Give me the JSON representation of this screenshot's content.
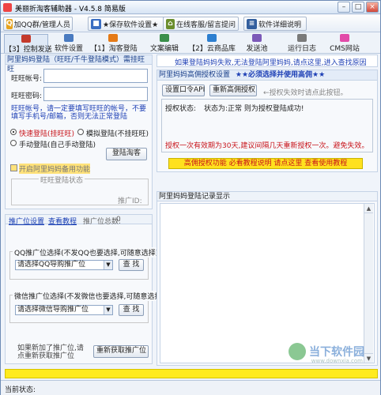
{
  "window": {
    "title": "美丽折淘客辅助器 - V4.5.8 简易版"
  },
  "toolbar": {
    "qq_group": "加QQ群/管理人员",
    "save_settings": "★保存软件设置★",
    "online_support": "在线客服/留言提问",
    "details": "软件详细说明"
  },
  "tabs": [
    {
      "label": "【3】控制发送"
    },
    {
      "label": "软件设置"
    },
    {
      "label": "【1】淘客登陆"
    },
    {
      "label": "文案编辑"
    },
    {
      "label": "【2】云商品库"
    },
    {
      "label": "发送池"
    },
    {
      "label": "运行日志"
    },
    {
      "label": "CMS网站"
    }
  ],
  "login": {
    "header": "阿里妈妈登陆（旺旺/千牛登陆模式）需挂旺旺",
    "account_label": "旺旺帐号:",
    "password_label": "旺旺密码:",
    "account_value": "",
    "password_value": "",
    "note": "旺旺帐号，请一定要填写旺旺的帐号，不要填写手机号/邮箱，否则无法正常登陆",
    "radio_fast": "快速登陆(挂旺旺)",
    "radio_sim": "模拟登陆(不挂旺旺)",
    "radio_manual": "手动登陆(自己手动登陆)",
    "login_button": "登陆淘客",
    "enable_check": "开启阿里妈妈备用功能",
    "status_group": "旺旺登陆状态",
    "promo_id": "推广ID:"
  },
  "promo": {
    "settings_link": "推广位设置",
    "tutorial_link": "查看教程",
    "total_label": "推广位总数:",
    "total_value": "0",
    "qq_group_title": "QQ推广位选择(不发QQ也要选择,可随意选择)",
    "qq_select": "请选择QQ导购推广位",
    "wx_group_title": "微信推广位选择(不发微信也要选择,可随意选择)",
    "wx_select": "请选择微信导购推广位",
    "search_button": "查 找",
    "new_hint": "如果新加了推广位,请点重新获取推广位",
    "refresh_button": "重新获取推广位"
  },
  "auth": {
    "notice": "如果登陆妈妈失败,无法登陆阿里妈妈,请点这里,进入查找原因",
    "header_title": "阿里妈妈高佣授权设置",
    "header_note": "★★必须选择并使用高佣★★",
    "set_password_button": "设置口令API",
    "reauth_button": "重新高佣授权",
    "hint": "←授权失效时请点此按钮。",
    "status_label": "授权状态:",
    "status_value": "状态为:正常  则为授权登陆成功!",
    "valid_note": "授权一次有效期为30天,建议间隔几天重新授权一次。避免失效。",
    "tutorial_bar": "高佣授权功能 必看教程说明 请点这里 查看使用教程"
  },
  "log": {
    "title": "阿里妈妈登陆记录显示"
  },
  "status": {
    "label": "当前状态:"
  },
  "watermark": {
    "text": "当下软件园",
    "sub": "www.downxia.com"
  },
  "colors": {
    "accent": "#1a3f8a",
    "red": "#d40000",
    "yellow": "#ffeb1e"
  }
}
